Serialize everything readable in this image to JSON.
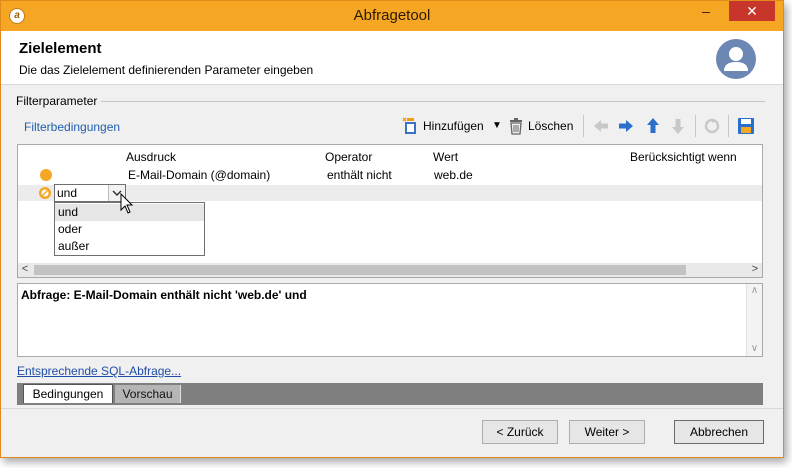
{
  "window": {
    "title": "Abfragetool",
    "minimize_label": "–",
    "close_label": "✕"
  },
  "header": {
    "title": "Zielelement",
    "subtitle": "Die das Zielelement definierenden Parameter eingeben"
  },
  "filter_group": {
    "label": "Filterparameter",
    "conditions_link": "Filterbedingungen"
  },
  "toolbar": {
    "add_label": "Hinzufügen",
    "delete_label": "Löschen"
  },
  "grid": {
    "columns": [
      "Ausdruck",
      "Operator",
      "Wert",
      "Berücksichtigt wenn"
    ],
    "rows": [
      {
        "expression": "E-Mail-Domain (@domain)",
        "operator": "enthält nicht",
        "value": "web.de"
      }
    ],
    "combo_value": "und",
    "dropdown_options": [
      "und",
      "oder",
      "außer"
    ],
    "dropdown_selected": "und"
  },
  "query": {
    "text": "Abfrage: E-Mail-Domain enthält nicht 'web.de' und"
  },
  "sql_link": "Entsprechende SQL-Abfrage...",
  "tabs": [
    "Bedingungen",
    "Vorschau"
  ],
  "footer": {
    "back_label": "< Zurück",
    "next_label": "Weiter >",
    "cancel_label": "Abbrechen"
  },
  "colors": {
    "titlebar": "#f5a623",
    "close_button": "#c7352b",
    "link": "#1f5fae",
    "condition_dot": "#f5a623"
  }
}
